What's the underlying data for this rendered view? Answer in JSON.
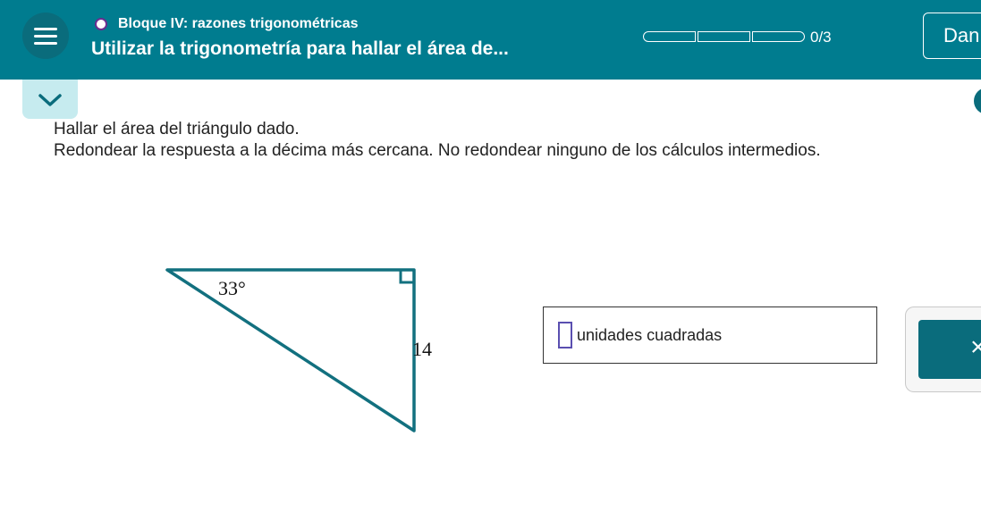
{
  "header": {
    "topic": "Bloque IV: razones trigonométricas",
    "subtitle": "Utilizar la trigonometría para hallar el área de...",
    "progress": {
      "count": "0/3",
      "done": 0,
      "total": 3
    },
    "right_button_label": "Dan",
    "colors": {
      "bar": "#007c8f",
      "topic_dot": "#6b2d8f"
    }
  },
  "icons": {
    "menu": "hamburger-menu-icon",
    "topic": "circle-icon",
    "collapse": "chevron-down-icon",
    "clear": "close-icon"
  },
  "problem": {
    "line1": "Hallar el área del triángulo dado.",
    "line2": "Redondear la respuesta a la décima más cercana. No redondear ninguno de los cálculos intermedios."
  },
  "figure": {
    "angle_label": "33°",
    "side_label": "14"
  },
  "answer": {
    "value": "",
    "unit": "unidades cuadradas"
  },
  "controls": {
    "clear_symbol": "×"
  }
}
